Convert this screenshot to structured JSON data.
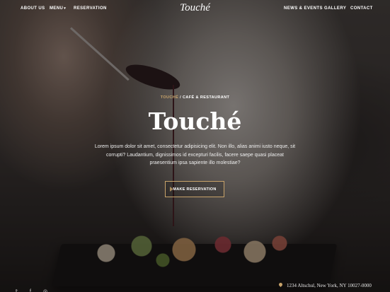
{
  "nav": {
    "left": [
      {
        "label": "ABOUT US"
      },
      {
        "label": "MENU",
        "caret": "▾"
      },
      {
        "label": "RESERVATION"
      }
    ],
    "brand": "Touché",
    "right": [
      {
        "label": "NEWS & EVENTS"
      },
      {
        "label": "GALLERY"
      },
      {
        "label": "CONTACT"
      }
    ]
  },
  "hero": {
    "kicker_accent": "TOUCHÉ",
    "kicker_sep": " / ",
    "kicker_rest": "CAFÉ & RESTAURANT",
    "title": "Touché",
    "description": "Lorem ipsum dolor sit amet, consectetur adipisicing elit. Non illo, alias animi iusto neque, sit corrupti? Laudantium, dignissimos id excepturi facilis, facere saepe quasi placeat praesentium ipsa sapiente illo molestiae?",
    "cta_label": "MAKE RESERVATION"
  },
  "footer": {
    "social": [
      {
        "icon": "twitter-icon",
        "glyph": "𝕥"
      },
      {
        "icon": "facebook-icon",
        "glyph": "f"
      },
      {
        "icon": "instagram-icon",
        "glyph": "◎"
      }
    ],
    "address": "1234 Altschul, New York, NY 10027-0000"
  },
  "colors": {
    "accent": "#c8a36a",
    "text": "#ffffff"
  }
}
